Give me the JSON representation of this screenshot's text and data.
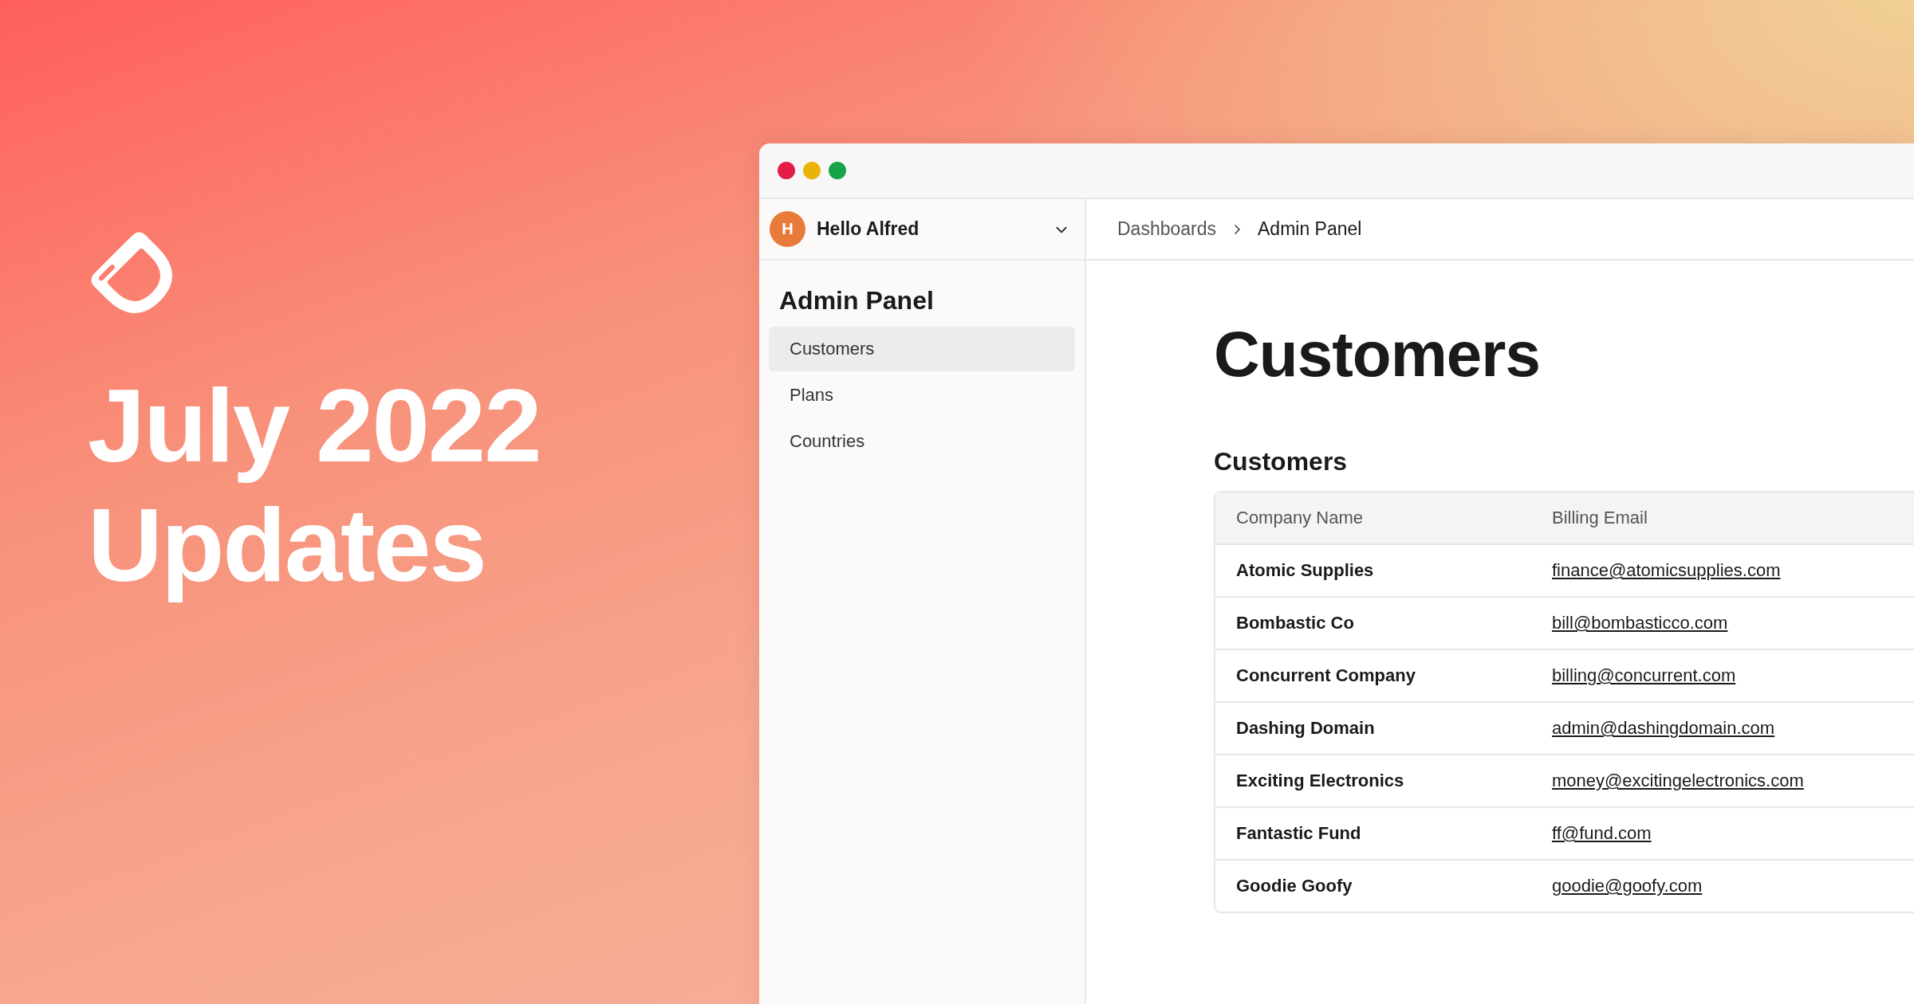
{
  "banner": {
    "title_lines": [
      "July 2022",
      "Updates"
    ]
  },
  "window": {
    "traffic_lights": [
      {
        "color": "#e11d48"
      },
      {
        "color": "#eab308"
      },
      {
        "color": "#16a34a"
      }
    ]
  },
  "sidebar": {
    "user": {
      "initial": "H",
      "name": "Hello Alfred"
    },
    "title": "Admin Panel",
    "items": [
      {
        "label": "Customers",
        "selected": true
      },
      {
        "label": "Plans",
        "selected": false
      },
      {
        "label": "Countries",
        "selected": false
      }
    ]
  },
  "breadcrumb": [
    "Dashboards",
    "Admin Panel"
  ],
  "page": {
    "heading": "Customers",
    "section_title": "Customers"
  },
  "table": {
    "columns": [
      "Company Name",
      "Billing Email"
    ],
    "rows": [
      [
        "Atomic Supplies",
        "finance@atomicsupplies.com"
      ],
      [
        "Bombastic Co",
        "bill@bombasticco.com"
      ],
      [
        "Concurrent Company",
        "billing@concurrent.com"
      ],
      [
        "Dashing Domain",
        "admin@dashingdomain.com"
      ],
      [
        "Exciting Electronics",
        "money@excitingelectronics.com"
      ],
      [
        "Fantastic Fund",
        "ff@fund.com"
      ],
      [
        "Goodie Goofy",
        "goodie@goofy.com"
      ]
    ]
  }
}
